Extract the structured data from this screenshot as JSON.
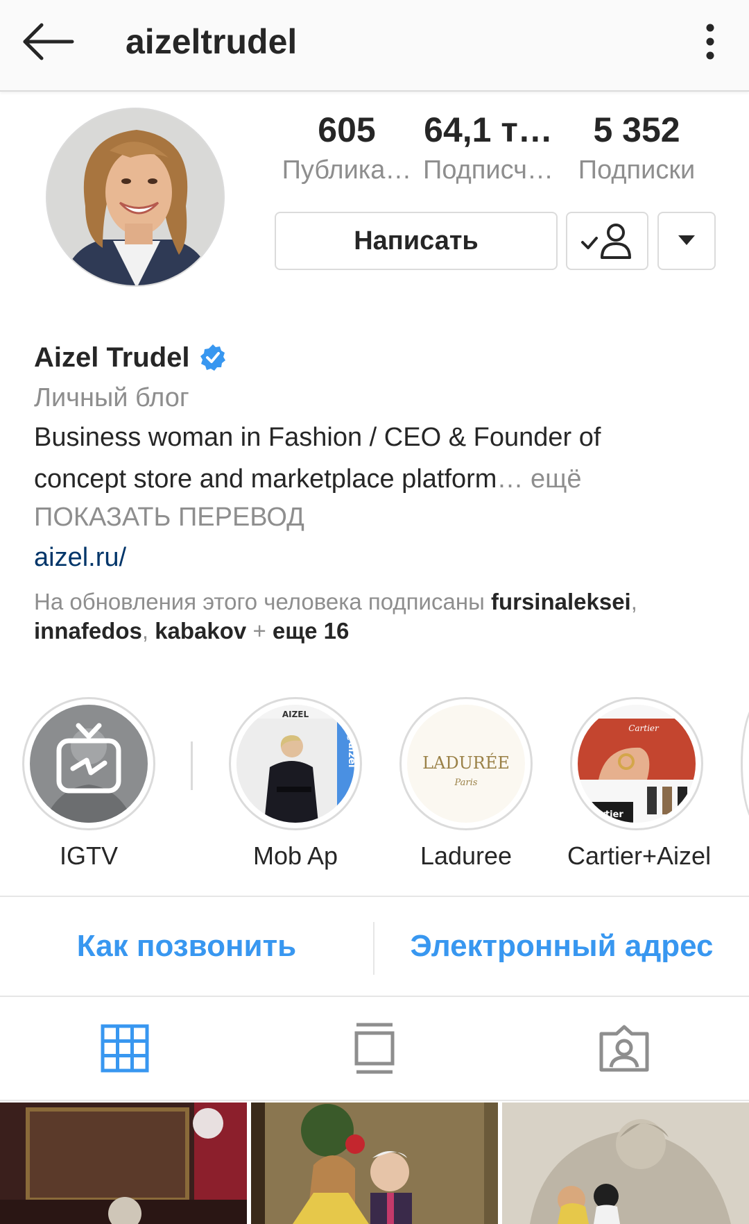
{
  "topbar": {
    "username": "aizeltrudel",
    "back_icon": "arrow-left-icon",
    "menu_icon": "more-vertical-icon"
  },
  "stats": [
    {
      "value": "605",
      "label": "Публика…"
    },
    {
      "value": "64,1 т…",
      "label": "Подписч…"
    },
    {
      "value": "5 352",
      "label": "Подписки"
    }
  ],
  "actions": {
    "message_label": "Написать",
    "following_icon": "user-check-icon",
    "dropdown_icon": "triangle-down-icon"
  },
  "profile": {
    "full_name": "Aizel Trudel",
    "verified_icon": "verified-badge-icon",
    "category": "Личный блог",
    "bio_line1": "Business woman in Fashion / CEO & Founder of",
    "bio_line2": "concept store and marketplace platform",
    "bio_more": "… ещё",
    "translate": "ПОКАЗАТЬ ПЕРЕВОД",
    "website": "aizel.ru/"
  },
  "followed_by": {
    "prefix": "На обновления этого человека подписаны ",
    "user1": "fursinaleksei",
    "sep1": ", ",
    "user2": "innafedos",
    "sep2": ", ",
    "user3": "kabakov",
    "plus": " + ",
    "more": "еще 16"
  },
  "highlights": [
    {
      "label": "IGTV",
      "icon": "igtv-icon"
    },
    {
      "label": "Mob Ap",
      "text1": "AIZEL",
      "text2": "@aizel"
    },
    {
      "label": "Laduree",
      "text1": "LADURÉE",
      "text2": "Paris"
    },
    {
      "label": "Cartier+Aizel",
      "text1": "Cartier",
      "text2": "@cartier"
    }
  ],
  "contact": {
    "call_label": "Как позвонить",
    "email_label": "Электронный адрес"
  },
  "tabs": [
    {
      "icon": "grid-icon",
      "active": true
    },
    {
      "icon": "feed-icon",
      "active": false
    },
    {
      "icon": "tagged-icon",
      "active": false
    }
  ],
  "colors": {
    "accent": "#3897f0",
    "link": "#003569",
    "secondary_text": "#8e8e8e",
    "border": "#dbdbdb"
  }
}
